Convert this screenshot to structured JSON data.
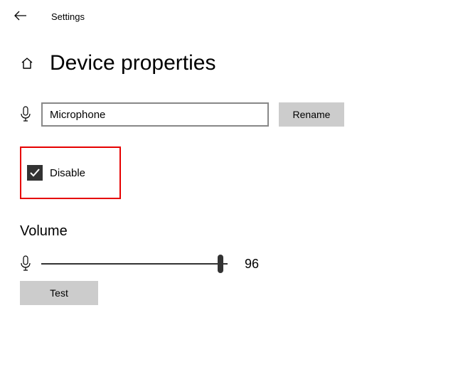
{
  "header": {
    "title": "Settings"
  },
  "page": {
    "title": "Device properties"
  },
  "device": {
    "name": "Microphone",
    "rename_label": "Rename"
  },
  "disable": {
    "label": "Disable",
    "checked": true
  },
  "volume": {
    "label": "Volume",
    "value": 96,
    "test_label": "Test"
  }
}
